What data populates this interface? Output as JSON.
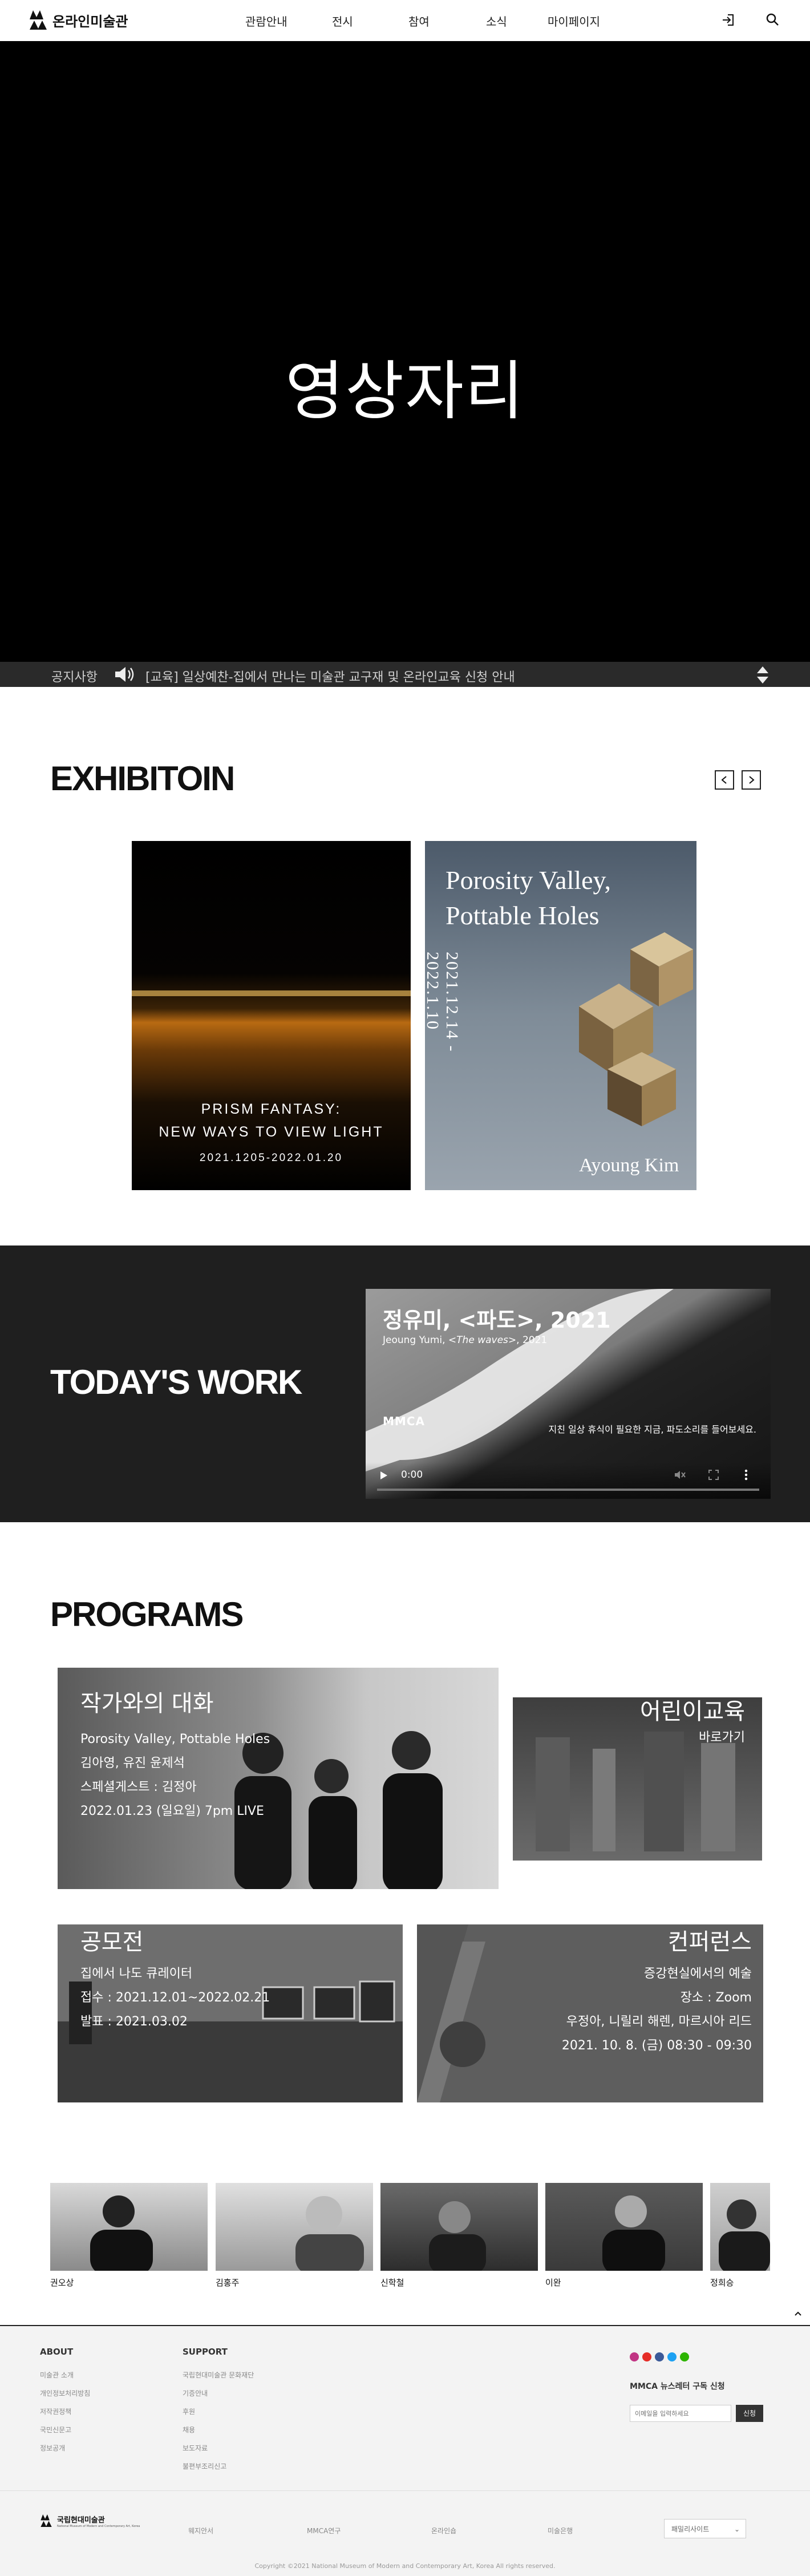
{
  "header": {
    "logo_text": "온라인미술관",
    "nav": [
      "관람안내",
      "전시",
      "참여",
      "소식",
      "마이페이지"
    ]
  },
  "hero": {
    "title": "영상자리"
  },
  "notice": {
    "label": "공지사항",
    "text": "[교육] 일상예찬-집에서 만나는 미술관 교구재 및 온라인교육 신청 안내"
  },
  "exhibition": {
    "title": "EXHIBITOIN",
    "cards": [
      {
        "line1": "PRISM FANTASY:",
        "line2": "NEW WAYS TO VIEW LIGHT",
        "date": "2021.1205-2022.01.20"
      },
      {
        "title1": "Porosity Valley,",
        "title2": "Pottable Holes",
        "date": "2021.12.14 - 2022.1.10",
        "artist": "Ayoung Kim"
      }
    ]
  },
  "today": {
    "title": "TODAY'S WORK",
    "video_title": "정유미, <파도>, 2021",
    "video_sub_a": "Jeoung Yumi, <",
    "video_sub_italic": "The waves",
    "video_sub_b": ">, 2021",
    "overlay": "지친 일상 휴식이 필요한 지금, 파도소리를 들어보세요.",
    "time": "0:00",
    "brand": "MMCA"
  },
  "programs": {
    "title": "PROGRAMS",
    "artist_talk": {
      "title": "작가와의 대화",
      "lines": [
        "Porosity Valley, Pottable Holes",
        "김아영, 유진 윤제석",
        "스페셜게스트 : 김정아",
        "2022.01.23 (일요일) 7pm LIVE"
      ]
    },
    "kids": {
      "title": "어린이교육",
      "link": "바로가기"
    },
    "contest": {
      "title": "공모전",
      "lines": [
        "집에서 나도 큐레이터",
        "접수 : 2021.12.01~2022.02.21",
        "발표 : 2021.03.02"
      ]
    },
    "conference": {
      "title": "컨퍼런스",
      "lines": [
        "증강현실에서의 예술",
        "장소 : Zoom",
        "우정아, 니릴리 해렌, 마르시아 리드",
        "2021. 10. 8. (금) 08:30 - 09:30"
      ]
    }
  },
  "people": [
    "권오상",
    "김홍주",
    "신학철",
    "이완",
    "정희승"
  ],
  "footer": {
    "about_title": "ABOUT",
    "about_items": [
      "미술관 소개",
      "개인정보처리방침",
      "저작권정책",
      "국민신문고",
      "정보공개"
    ],
    "support_title": "SUPPORT",
    "support_items": [
      "국립현대미술관 문화재단",
      "기증안내",
      "후원",
      "채용",
      "보도자료",
      "불편부조리신고"
    ],
    "newsletter_title": "MMCA 뉴스레터 구독 신청",
    "newsletter_placeholder": "이메일을 입력하세요",
    "newsletter_button": "신청",
    "bottom_logo": "국립현대미술관",
    "bottom_logo_sub": "National Museum of Modern and Contemporary Art, Korea",
    "bottom_links": [
      "웨지안서",
      "MMCA연구",
      "온라인숍",
      "미술은행"
    ],
    "family_site": "패밀리사이트",
    "copyright": "Copyright ©2021 National Museum of Modern and Contemporary Art, Korea All rights reserved."
  },
  "colors": {
    "dark": "#1f1f1f",
    "notice_bar": "#2a2a2a",
    "footer_bg": "#f3f3f3"
  }
}
